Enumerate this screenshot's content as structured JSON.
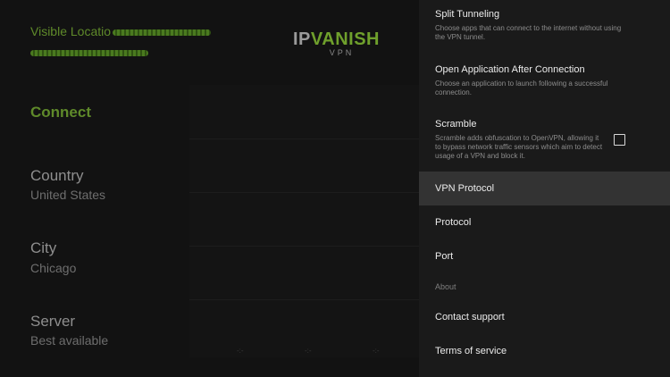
{
  "main": {
    "visible_location_label": "Visible Locatio",
    "logo": {
      "ip": "IP",
      "vanish": "VANISH",
      "vpn": "VPN"
    },
    "connect_label": "Connect",
    "country": {
      "label": "Country",
      "value": "United States"
    },
    "city": {
      "label": "City",
      "value": "Chicago"
    },
    "server": {
      "label": "Server",
      "value": "Best available"
    }
  },
  "settings": {
    "split_tunneling": {
      "title": "Split Tunneling",
      "desc": "Choose apps that can connect to the internet without using the VPN tunnel."
    },
    "open_app": {
      "title": "Open Application After Connection",
      "desc": "Choose an application to launch following a successful connection."
    },
    "scramble": {
      "title": "Scramble",
      "desc": "Scramble adds obfuscation to OpenVPN, allowing it to bypass network traffic sensors which aim to detect usage of a VPN and block it.",
      "checked": false
    },
    "vpn_protocol": "VPN Protocol",
    "protocol": "Protocol",
    "port": "Port",
    "about_header": "About",
    "contact_support": "Contact support",
    "terms": "Terms of service"
  }
}
